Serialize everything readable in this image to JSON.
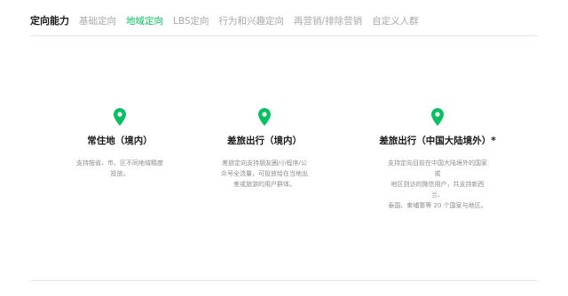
{
  "header": {
    "section_label": "定向能力",
    "tabs": [
      {
        "label": "基础定向",
        "active": false
      },
      {
        "label": "地域定向",
        "active": true
      },
      {
        "label": "LBS定向",
        "active": false
      },
      {
        "label": "行为和兴趣定向",
        "active": false
      },
      {
        "label": "再营销/排除营销",
        "active": false
      },
      {
        "label": "自定义人群",
        "active": false
      }
    ]
  },
  "colors": {
    "accent": "#07c160",
    "title_text": "#1a1a1a",
    "muted_text": "#a8a8a8",
    "desc_text": "#8c8c8c",
    "divider": "#e6e6e6"
  },
  "cards": [
    {
      "icon": "location-pin-icon",
      "title": "常住地（境内）",
      "desc_lines": [
        "支持按省、市、区不同地域精度",
        "投放。"
      ]
    },
    {
      "icon": "location-pin-icon",
      "title": "差旅出行（境内）",
      "desc_lines": [
        "差旅定向支持朋友圈/小程序/公",
        "众号全流量，可投放给在当地出",
        "差或旅游的用户群体。"
      ]
    },
    {
      "icon": "location-pin-icon",
      "title": "差旅出行（中国大陆境外）*",
      "desc_lines": [
        "支持定向目前在中国大陆境外的国家或",
        "地区到访的微信用户，共支持新西兰、",
        "泰国、柬埔寨等 20 个国家与地区。"
      ]
    }
  ]
}
